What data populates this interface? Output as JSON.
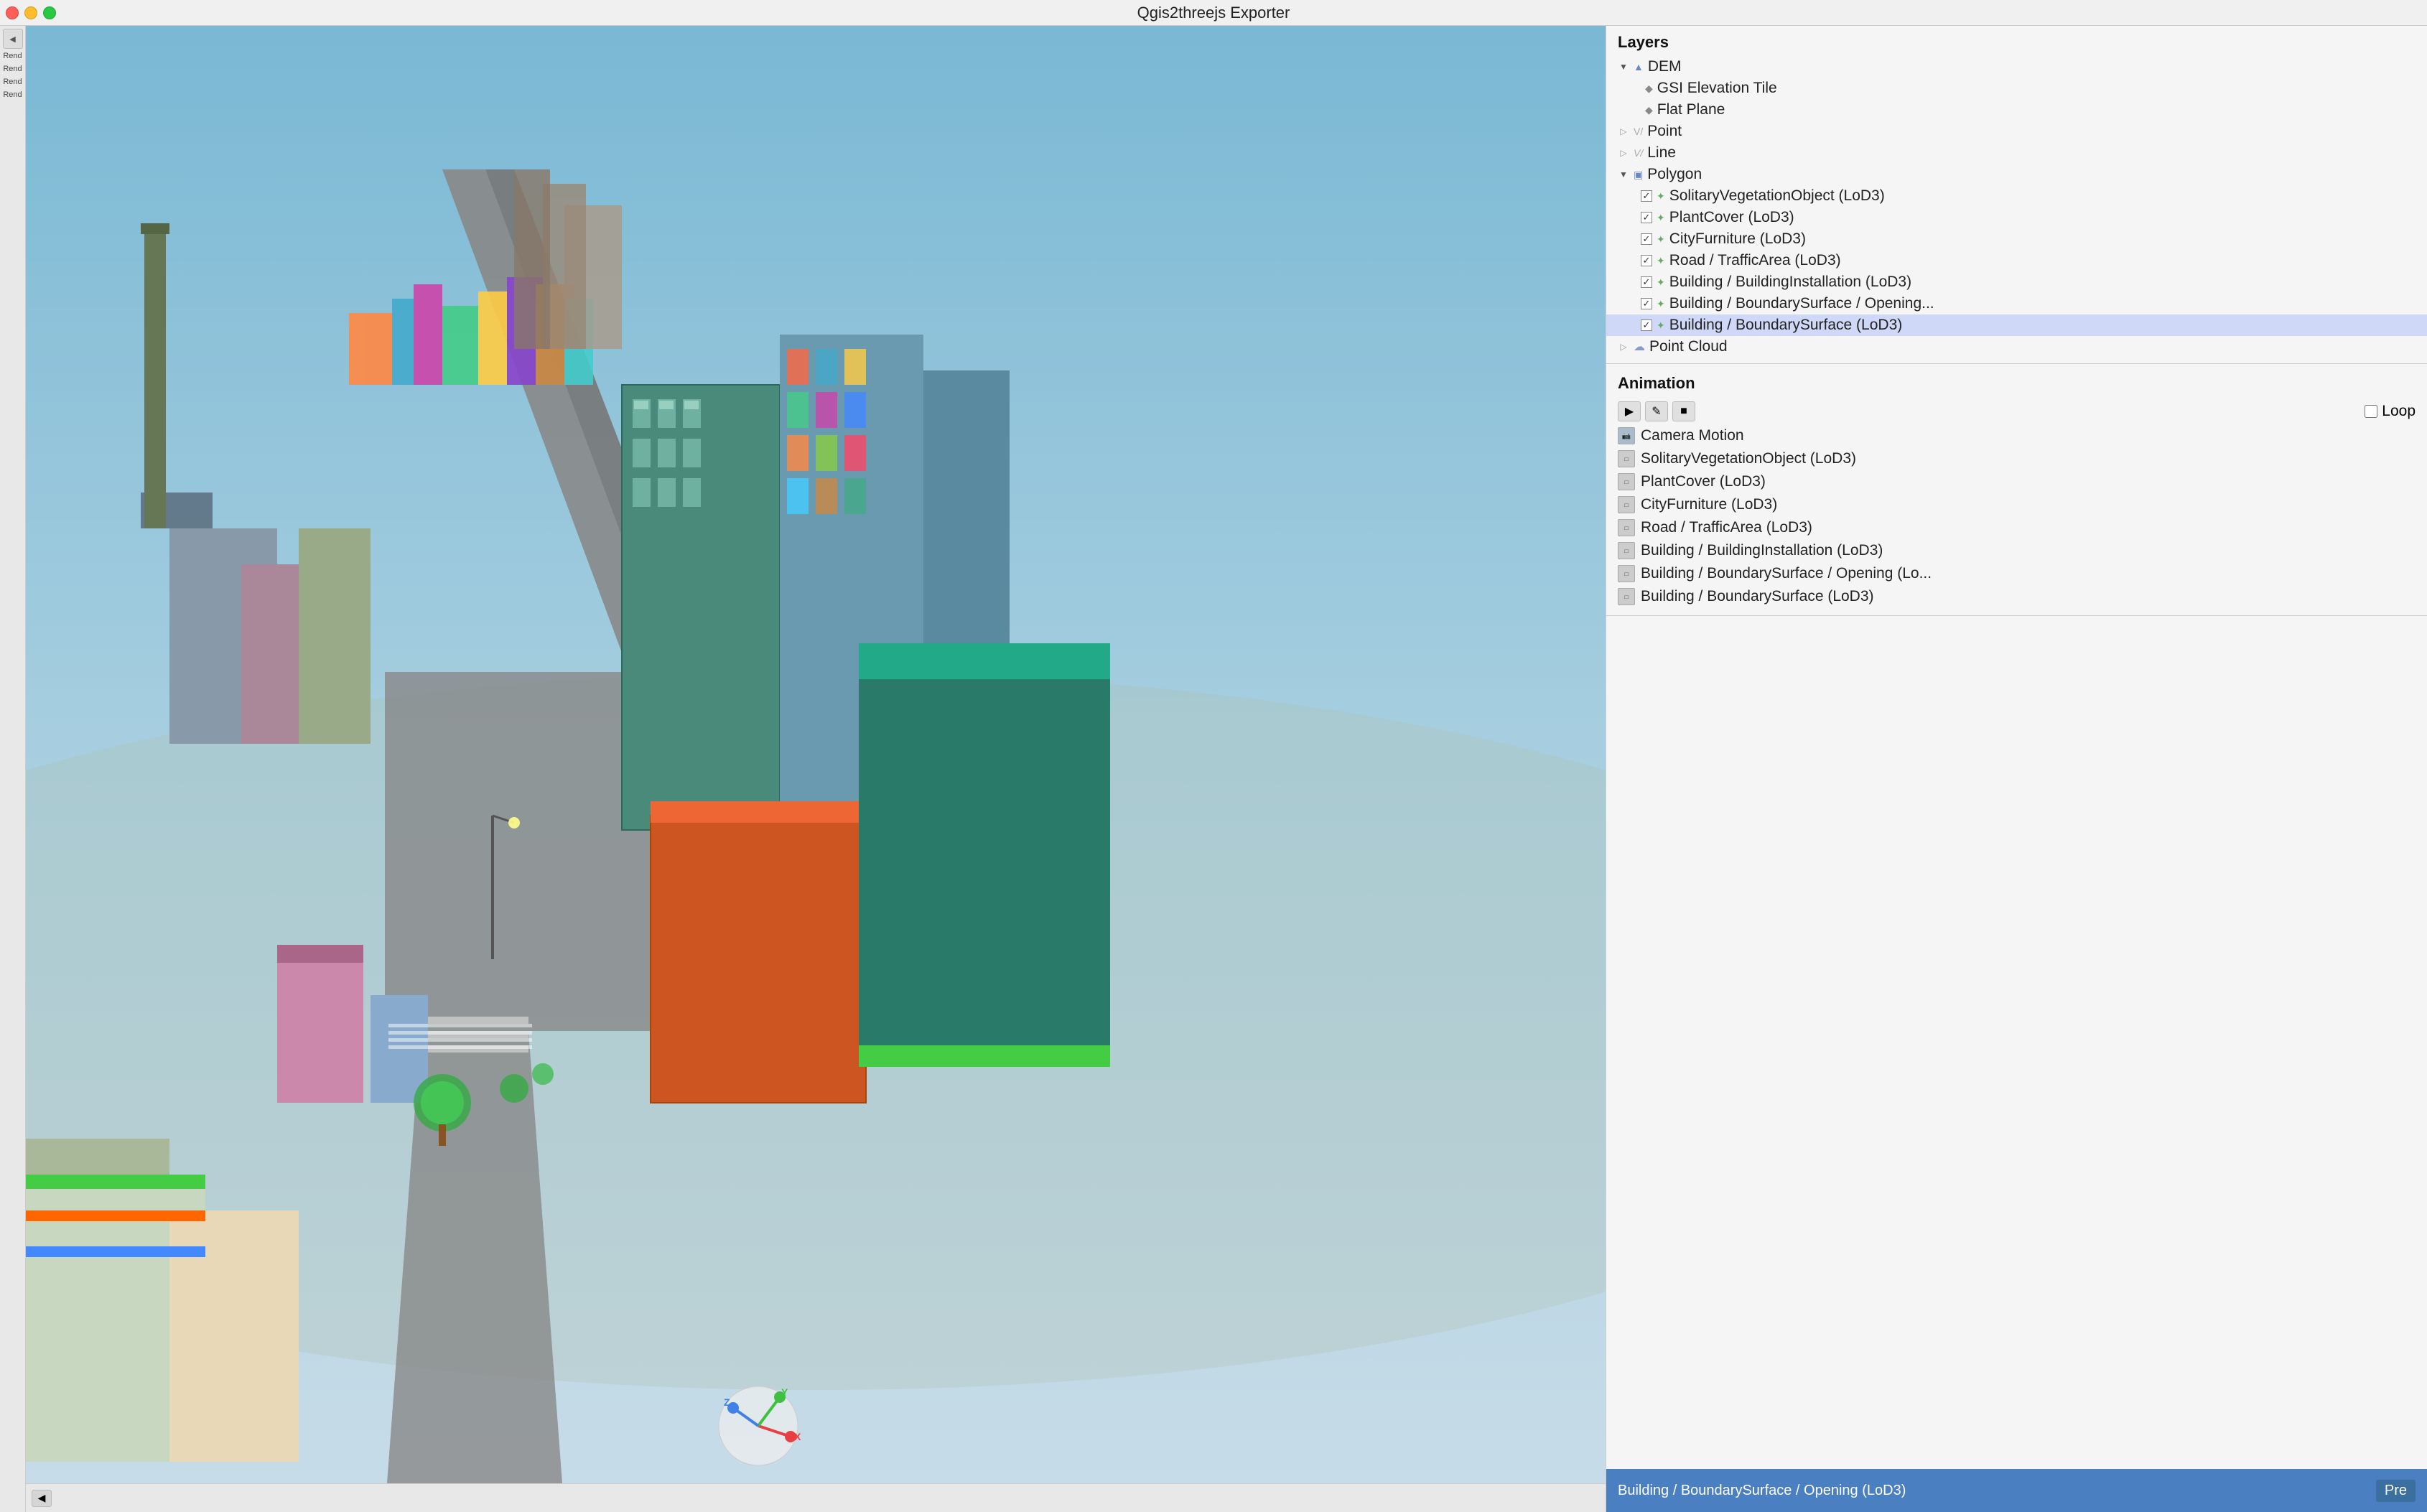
{
  "app": {
    "title": "Qgis2threejs Exporter"
  },
  "titlebar": {
    "title": "Qgis2threejs Exporter",
    "close": "×",
    "minimize": "−",
    "maximize": "+"
  },
  "left_strip": {
    "labels": [
      "Rend",
      "Rend",
      "Rend",
      "Rend"
    ]
  },
  "layers": {
    "header": "Layers",
    "items": [
      {
        "id": "dem",
        "label": "DEM",
        "level": 0,
        "type": "group",
        "expanded": true,
        "checked": null,
        "icon": "triangle"
      },
      {
        "id": "gsi",
        "label": "GSI Elevation Tile",
        "level": 1,
        "type": "item",
        "checked": false,
        "icon": "diamond"
      },
      {
        "id": "flat",
        "label": "Flat Plane",
        "level": 1,
        "type": "item",
        "checked": false,
        "icon": "diamond"
      },
      {
        "id": "point",
        "label": "Point",
        "level": 0,
        "type": "group",
        "checked": false,
        "icon": "dot"
      },
      {
        "id": "line",
        "label": "Line",
        "level": 0,
        "type": "group",
        "checked": false,
        "icon": "line"
      },
      {
        "id": "polygon",
        "label": "Polygon",
        "level": 0,
        "type": "group",
        "expanded": true,
        "checked": null,
        "icon": "polygon"
      },
      {
        "id": "solitary",
        "label": "SolitaryVegetationObject (LoD3)",
        "level": 1,
        "type": "item",
        "checked": true,
        "icon": "leaf"
      },
      {
        "id": "plantcover",
        "label": "PlantCover (LoD3)",
        "level": 1,
        "type": "item",
        "checked": true,
        "icon": "leaf"
      },
      {
        "id": "cityfurniture",
        "label": "CityFurniture (LoD3)",
        "level": 1,
        "type": "item",
        "checked": true,
        "icon": "leaf"
      },
      {
        "id": "road",
        "label": "Road / TrafficArea (LoD3)",
        "level": 1,
        "type": "item",
        "checked": true,
        "icon": "leaf"
      },
      {
        "id": "building_inst",
        "label": "Building / BuildingInstallation (LoD3)",
        "level": 1,
        "type": "item",
        "checked": true,
        "icon": "leaf"
      },
      {
        "id": "building_bound_open",
        "label": "Building / BoundarySurface / Opening...",
        "level": 1,
        "type": "item",
        "checked": true,
        "icon": "leaf"
      },
      {
        "id": "building_bound",
        "label": "Building / BoundarySurface (LoD3)",
        "level": 1,
        "type": "item",
        "checked": true,
        "selected": true,
        "icon": "leaf"
      },
      {
        "id": "pointcloud",
        "label": "Point Cloud",
        "level": 0,
        "type": "group",
        "checked": false,
        "icon": "cloud"
      }
    ]
  },
  "animation": {
    "header": "Animation",
    "loop_label": "Loop",
    "buttons": {
      "play": "▶",
      "edit": "✎",
      "stop": "■"
    },
    "items": [
      {
        "id": "camera",
        "label": "Camera Motion",
        "icon": "cam"
      },
      {
        "id": "solitary",
        "label": "SolitaryVegetationObject (LoD3)",
        "icon": "layer"
      },
      {
        "id": "plantcover",
        "label": "PlantCover (LoD3)",
        "icon": "layer"
      },
      {
        "id": "cityfurniture",
        "label": "CityFurniture (LoD3)",
        "icon": "layer"
      },
      {
        "id": "road",
        "label": "Road / TrafficArea (LoD3)",
        "icon": "layer"
      },
      {
        "id": "building_inst",
        "label": "Building / BuildingInstallation (LoD3)",
        "icon": "layer"
      },
      {
        "id": "building_bound_open",
        "label": "Building / BoundarySurface / Opening (Lo...",
        "icon": "layer"
      },
      {
        "id": "building_bound",
        "label": "Building / BoundarySurface (LoD3)",
        "icon": "layer"
      }
    ]
  },
  "status_bar": {
    "text": "Building / BoundarySurface / Opening (LoD3)",
    "pre_label": "Pre"
  },
  "axis": {
    "x_color": "#e84040",
    "y_color": "#40c040",
    "z_color": "#4080e8"
  }
}
